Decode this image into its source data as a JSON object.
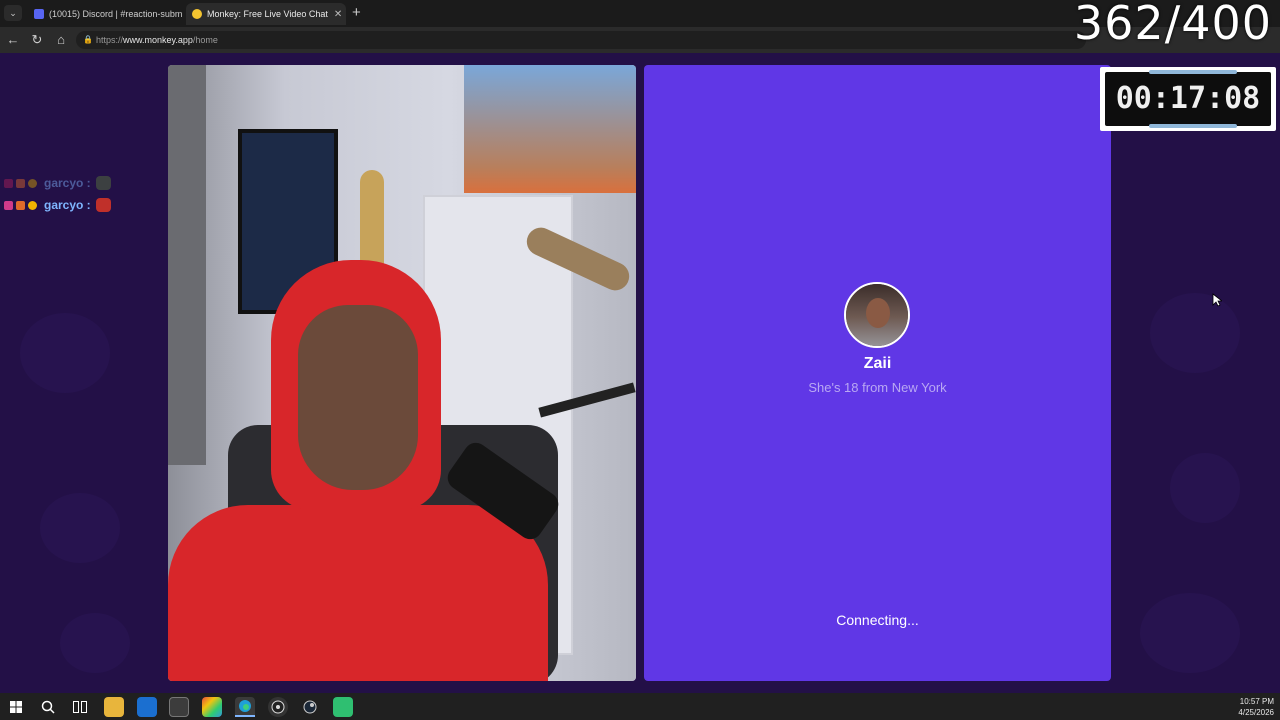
{
  "browser": {
    "tabs": [
      {
        "title": "(10015) Discord | #reaction-subm",
        "favicon_color": "#5865f2"
      },
      {
        "title": "Monkey: Free Live Video Chat",
        "favicon_color": "#f4c430"
      }
    ],
    "url_scheme": "https://",
    "url_host": "www.monkey.app",
    "url_path": "/home"
  },
  "chat": [
    {
      "user": "garcyo :",
      "badge_colors": [
        "#b0205a",
        "#e06a2a",
        "#d8a400"
      ],
      "emote_color": "#5c7a3a",
      "faded": true
    },
    {
      "user": "garcyo :",
      "badge_colors": [
        "#d03a8a",
        "#e06a2a",
        "#f2b400"
      ],
      "emote_color": "#c0302a",
      "faded": false
    }
  ],
  "remote": {
    "name": "Zaii",
    "info": "She's 18 from New York",
    "status": "Connecting...",
    "bg_color": "#6037e6"
  },
  "overlay": {
    "counter": "362/400",
    "timer": "00:17:08"
  },
  "clock": {
    "time": "10:57 PM",
    "date": "4/25/2026"
  },
  "taskbar_icons": [
    "windows-icon",
    "search-icon",
    "task-view-icon",
    "file-explorer-icon",
    "outlook-icon",
    "store-icon",
    "paint-icon",
    "edge-icon",
    "obs-icon",
    "steam-icon",
    "android-app-icon"
  ]
}
